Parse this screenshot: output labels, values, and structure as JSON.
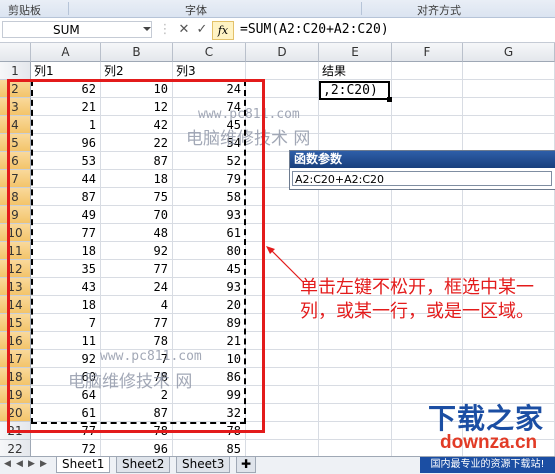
{
  "ribbon": {
    "groups": [
      "剪贴板",
      "字体",
      "对齐方式"
    ]
  },
  "formula_bar": {
    "name_box": "SUM",
    "cancel": "✕",
    "enter": "✓",
    "fx": "fx",
    "formula": "=SUM(A2:C20+A2:C20)"
  },
  "columns": [
    "A",
    "B",
    "C",
    "D",
    "E",
    "F",
    "G"
  ],
  "rows": [
    "1",
    "2",
    "3",
    "4",
    "5",
    "6",
    "7",
    "8",
    "9",
    "10",
    "11",
    "12",
    "13",
    "14",
    "15",
    "16",
    "17",
    "18",
    "19",
    "20",
    "21",
    "22"
  ],
  "header_row": {
    "a": "列1",
    "b": "列2",
    "c": "列3",
    "e": "结果"
  },
  "data": [
    [
      62,
      10,
      24
    ],
    [
      21,
      12,
      74
    ],
    [
      1,
      42,
      45
    ],
    [
      96,
      22,
      54
    ],
    [
      53,
      87,
      52
    ],
    [
      44,
      18,
      79
    ],
    [
      87,
      75,
      58
    ],
    [
      49,
      70,
      93
    ],
    [
      77,
      48,
      61
    ],
    [
      18,
      92,
      80
    ],
    [
      35,
      77,
      45
    ],
    [
      43,
      24,
      93
    ],
    [
      18,
      4,
      20
    ],
    [
      7,
      77,
      89
    ],
    [
      11,
      78,
      21
    ],
    [
      92,
      7,
      10
    ],
    [
      60,
      78,
      86
    ],
    [
      64,
      2,
      99
    ],
    [
      61,
      87,
      32
    ],
    [
      77,
      78,
      78
    ],
    [
      72,
      96,
      85
    ]
  ],
  "active_cell": {
    "ref": "E2",
    "display": ",2:C20)"
  },
  "dialog": {
    "title": "函数参数",
    "arg_value": "A2:C20+A2:C20"
  },
  "watermark": {
    "url": "www.pc811.com",
    "text": "电脑维修技术 网"
  },
  "annotation": "单击左键不松开，框选中某一列，或某一行，或是一区域。",
  "sheet_tabs": [
    "Sheet1",
    "Sheet2",
    "Sheet3"
  ],
  "logo": {
    "title": "下载之家",
    "domain": "downza.cn",
    "slogan": "国内最专业的资源下载站!"
  },
  "colors": {
    "highlight_red": "#e31b1b",
    "dialog_blue": "#1b4ea3"
  }
}
